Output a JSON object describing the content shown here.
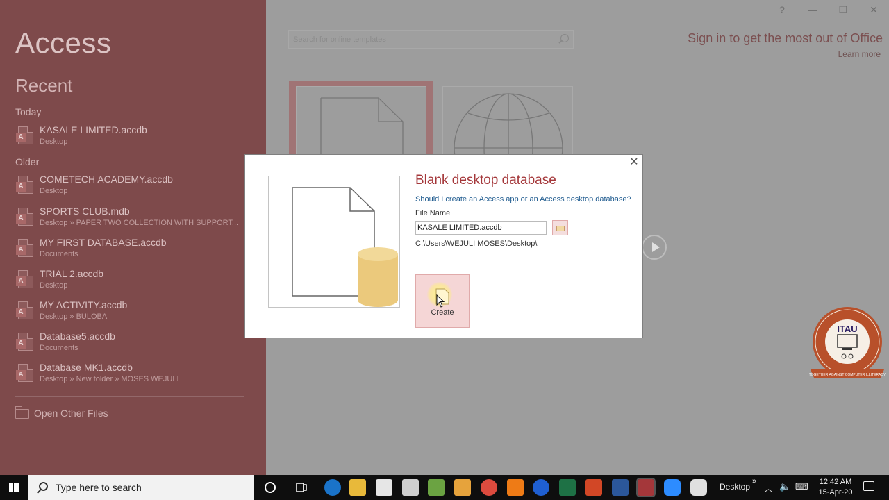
{
  "app": {
    "title": "Access",
    "recent_heading": "Recent"
  },
  "recent": {
    "today_label": "Today",
    "older_label": "Older",
    "items": [
      {
        "name": "KASALE LIMITED.accdb",
        "location": "Desktop"
      },
      {
        "name": "COMETECH ACADEMY.accdb",
        "location": "Desktop"
      },
      {
        "name": "SPORTS CLUB.mdb",
        "location": "Desktop » PAPER TWO COLLECTION WITH SUPPORT..."
      },
      {
        "name": "MY FIRST DATABASE.accdb",
        "location": "Documents"
      },
      {
        "name": "TRIAL 2.accdb",
        "location": "Desktop"
      },
      {
        "name": "MY ACTIVITY.accdb",
        "location": "Desktop » BULOBA"
      },
      {
        "name": "Database5.accdb",
        "location": "Documents"
      },
      {
        "name": "Database MK1.accdb",
        "location": "Desktop » New folder » MOSES WEJULI"
      }
    ],
    "open_other": "Open Other Files",
    "file_icon_letter": "A"
  },
  "window_controls": {
    "help": "?",
    "minimize": "—",
    "restore": "❐",
    "close": "✕"
  },
  "templates": {
    "search_placeholder": "Search for online templates",
    "signin": "Sign in to get the most out of Office",
    "learn_more": "Learn more"
  },
  "dialog": {
    "close": "✕",
    "title": "Blank desktop database",
    "link": "Should I create an Access app or an Access desktop database?",
    "file_name_label": "File Name",
    "file_name_value": "KASALE LIMITED.accdb",
    "path": "C:\\Users\\WEJULI MOSES\\Desktop\\",
    "create_label": "Create"
  },
  "logo": {
    "text": "ITAU",
    "ring_text": "ICT Teachers' Association of Uganda",
    "motto": "TOGETHER AGAINST COMPUTER ILLITERACY"
  },
  "taskbar": {
    "search_placeholder": "Type here to search",
    "desktop_label": "Desktop",
    "chevron": "»",
    "time": "12:42 AM",
    "date": "15-Apr-20",
    "apps": [
      "cortana-icon",
      "task-view-icon",
      "edge-icon",
      "file-explorer-icon",
      "store-icon",
      "mail-icon",
      "photos-icon",
      "media-player-icon",
      "chrome-icon",
      "vlc-icon",
      "bluetooth-icon",
      "excel-icon",
      "powerpoint-icon",
      "word-icon",
      "access-icon",
      "zoom-icon",
      "camera-icon"
    ]
  },
  "colors": {
    "backstage": "#7e4a4b",
    "accent": "#a4373a",
    "link": "#1f5b8f",
    "create_bg": "#f5d6d6",
    "taskbar": "#0e0e0e"
  }
}
